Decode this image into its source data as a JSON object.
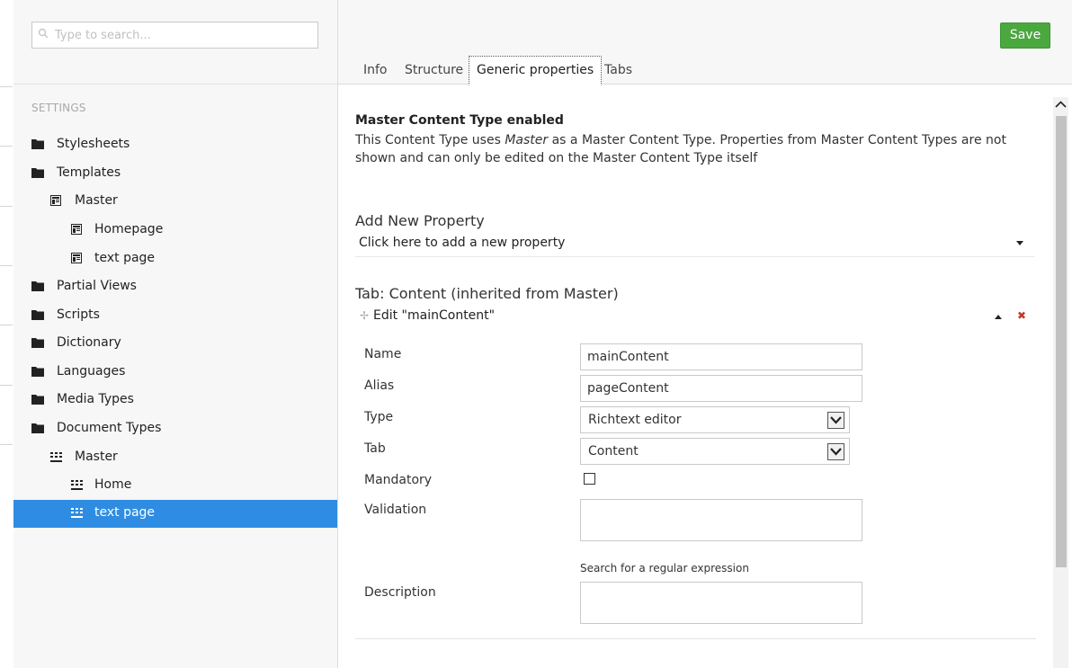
{
  "search": {
    "placeholder": "Type to search..."
  },
  "tree": {
    "section_title": "SETTINGS",
    "items": [
      {
        "label": "Stylesheets",
        "icon": "folder-icon"
      },
      {
        "label": "Templates",
        "icon": "folder-icon"
      },
      {
        "label": "Master",
        "icon": "template-icon"
      },
      {
        "label": "Homepage",
        "icon": "template-icon"
      },
      {
        "label": "text page",
        "icon": "template-icon"
      },
      {
        "label": "Partial Views",
        "icon": "folder-icon"
      },
      {
        "label": "Scripts",
        "icon": "folder-icon"
      },
      {
        "label": "Dictionary",
        "icon": "folder-icon"
      },
      {
        "label": "Languages",
        "icon": "folder-icon"
      },
      {
        "label": "Media Types",
        "icon": "folder-icon"
      },
      {
        "label": "Document Types",
        "icon": "folder-icon"
      },
      {
        "label": "Master",
        "icon": "document-type-icon"
      },
      {
        "label": "Home",
        "icon": "document-type-icon"
      },
      {
        "label": "text page",
        "icon": "document-type-icon",
        "selected": true
      }
    ]
  },
  "header": {
    "save_label": "Save",
    "tabs": [
      {
        "label": "Info"
      },
      {
        "label": "Structure"
      },
      {
        "label": "Generic properties",
        "active": true
      },
      {
        "label": "Tabs"
      }
    ]
  },
  "main": {
    "master_title": "Master Content Type enabled",
    "master_desc_prefix": "This Content Type uses ",
    "master_desc_em": "Master",
    "master_desc_suffix": " as a Master Content Type. Properties from Master Content Types are not shown and can only be edited on the Master Content Type itself",
    "add_property_title": "Add New Property",
    "add_property_select": "Click here to add a new property",
    "tab_title": "Tab: Content (inherited from Master)",
    "edit_label": "Edit \"mainContent\"",
    "fields": {
      "name_label": "Name",
      "name_value": "mainContent",
      "alias_label": "Alias",
      "alias_value": "pageContent",
      "type_label": "Type",
      "type_value": "Richtext editor",
      "tab_label": "Tab",
      "tab_value": "Content",
      "mandatory_label": "Mandatory",
      "mandatory_checked": false,
      "validation_label": "Validation",
      "validation_value": "",
      "regex_link": "Search for a regular expression",
      "description_label": "Description",
      "description_value": ""
    }
  },
  "colors": {
    "save_green": "#4aa83f",
    "selection_blue": "#2e8de2",
    "delete_red": "#c0392b"
  }
}
